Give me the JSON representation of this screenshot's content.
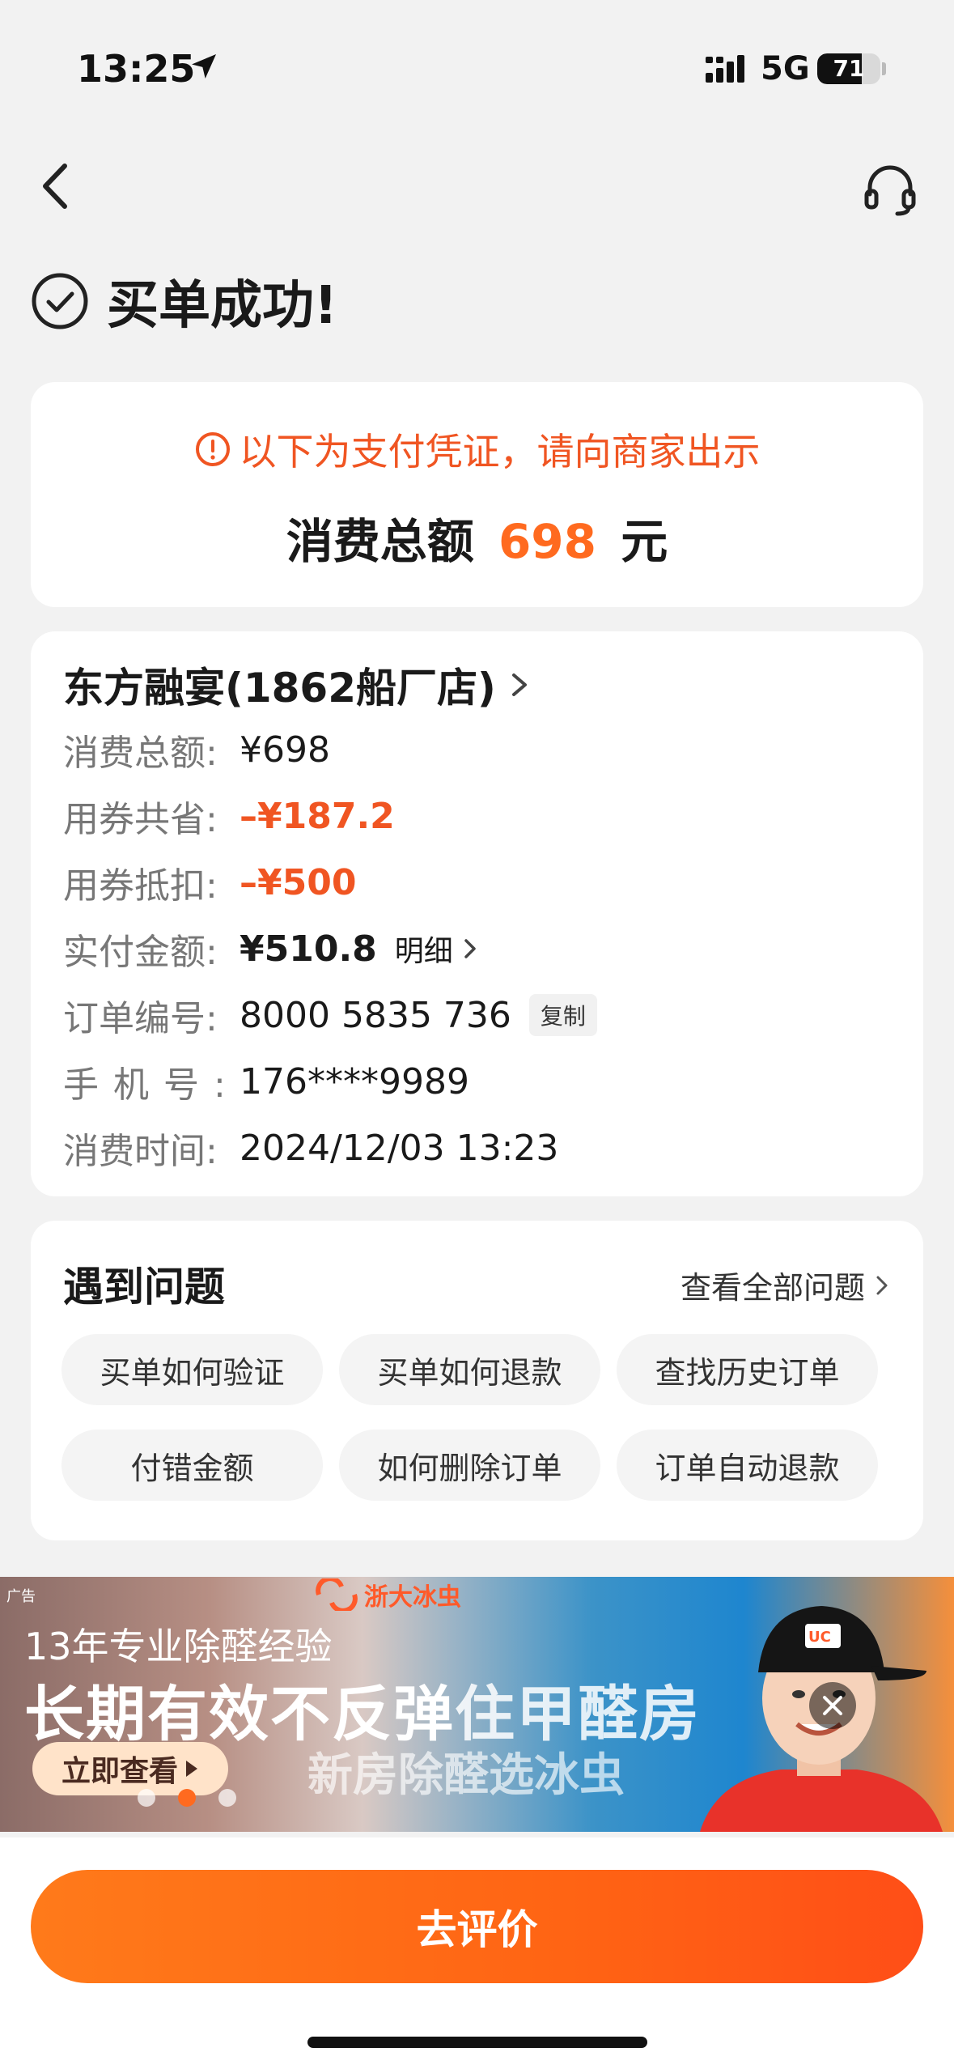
{
  "status_bar": {
    "time": "13:25",
    "network": "5G",
    "battery_level": 71,
    "battery_text": "71",
    "icons": [
      "location-arrow-icon",
      "signal-icon",
      "battery-icon"
    ]
  },
  "nav": {
    "back_icon": "chevron-left-icon",
    "service_icon": "headset-icon"
  },
  "page_title": "买单成功!",
  "voucher": {
    "notice": "以下为支付凭证，请向商家出示",
    "total_prefix": "消费总额",
    "total_amount": "698",
    "total_unit": "元",
    "colors": {
      "notice": "#f05522",
      "amount": "#ff6a1f"
    }
  },
  "order": {
    "shop_name": "东方融宴(1862船厂店)",
    "rows": [
      {
        "label": "消费总额:",
        "value": "¥698"
      },
      {
        "label": "用券共省:",
        "value": "–¥187.2"
      },
      {
        "label": "用券抵扣:",
        "value": "–¥500"
      },
      {
        "label": "实付金额:",
        "value": "¥510.8"
      },
      {
        "label": "订单编号:",
        "value": "8000 5835 736"
      },
      {
        "label": "手机号:",
        "value": "176****9989"
      },
      {
        "label": "消费时间:",
        "value": "2024/12/03 13:23"
      }
    ],
    "detail_label": "明细",
    "copy_label": "复制"
  },
  "faq": {
    "title": "遇到问题",
    "view_all": "查看全部问题",
    "chips": [
      "买单如何验证",
      "买单如何退款",
      "查找历史订单",
      "付错金额",
      "如何删除订单",
      "订单自动退款"
    ]
  },
  "ad": {
    "tag": "广告",
    "brand": "浙大冰虫",
    "line1": "13年专业除醛经验",
    "line2": "长期有效不反弹",
    "line2_overlay": "住甲醛房",
    "line3": "新房除醛选冰虫",
    "cta": "立即查看",
    "slides_total": 3,
    "slide_active": 2,
    "cap_logo": "UC"
  },
  "bottom": {
    "review_button": "去评价"
  }
}
